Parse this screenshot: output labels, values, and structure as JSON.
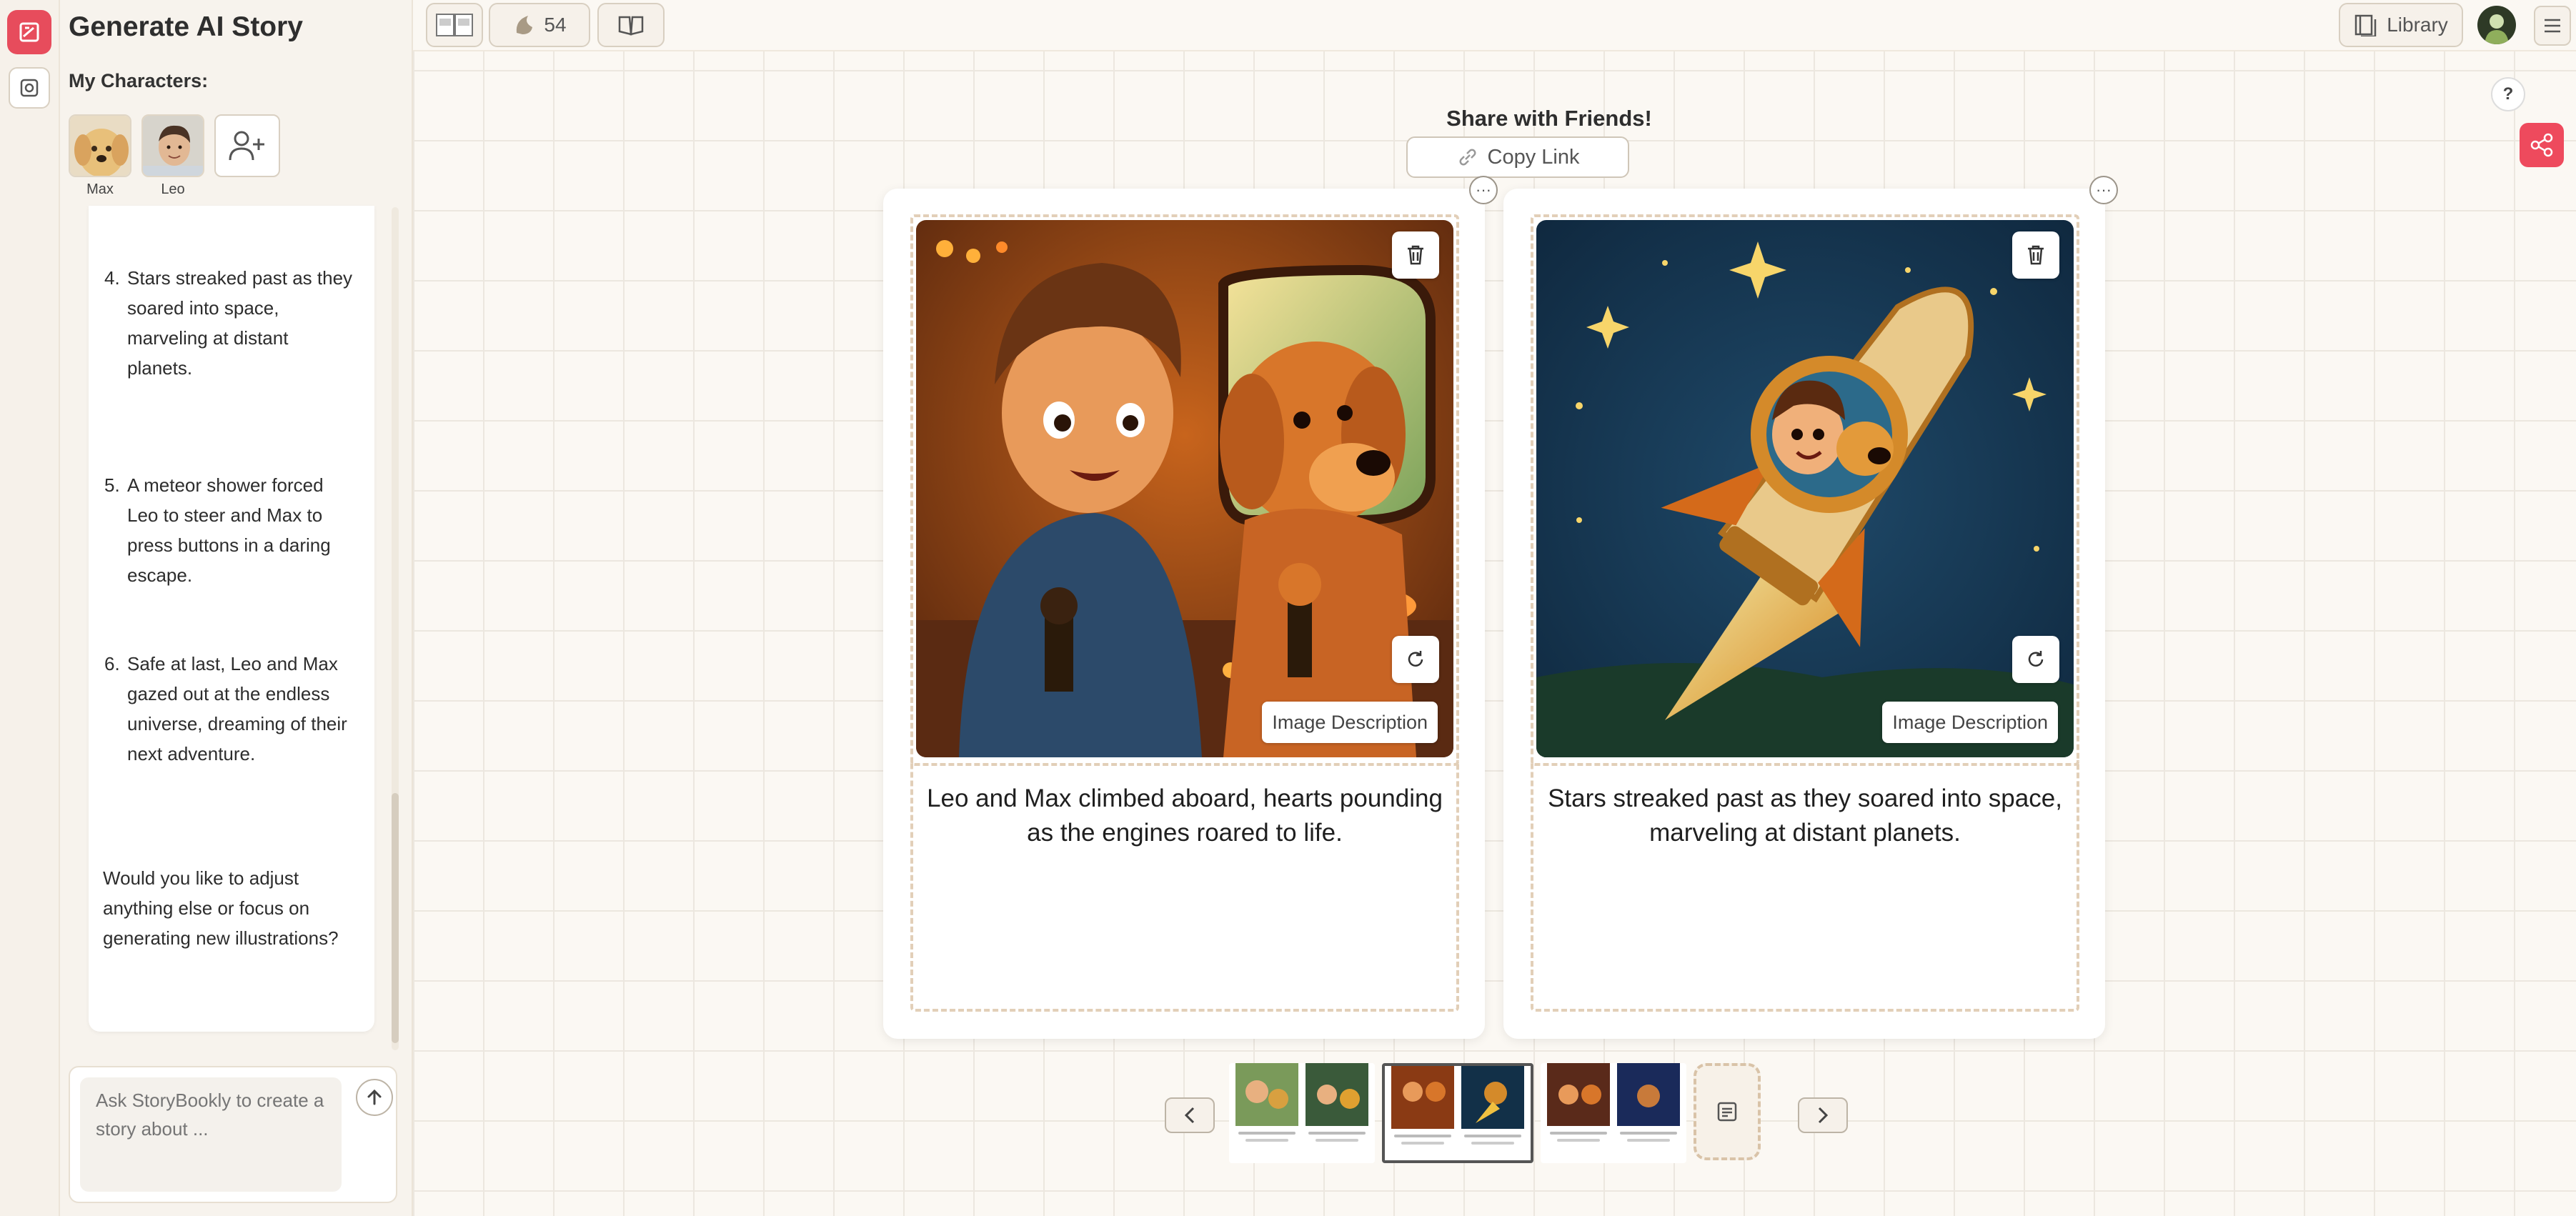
{
  "app": {
    "title": "Generate AI Story"
  },
  "characters": {
    "label": "My Characters:",
    "items": [
      {
        "name": "Max"
      },
      {
        "name": "Leo"
      }
    ]
  },
  "chat": {
    "story_items": [
      {
        "num": "4.",
        "text": "Stars streaked past as they soared into space, marveling at distant planets."
      },
      {
        "num": "5.",
        "text": "A meteor shower forced Leo to steer and Max to press buttons in a daring escape."
      },
      {
        "num": "6.",
        "text": "Safe at last, Leo and Max gazed out at the endless universe, dreaming of their next adventure."
      }
    ],
    "question": "Would you like to adjust anything else or focus on generating new illustrations?",
    "input_placeholder": "Ask StoryBookly to create a story about ..."
  },
  "toolbar": {
    "credits": "54",
    "library_label": "Library"
  },
  "share": {
    "title": "Share with Friends!",
    "copy_link_label": "Copy Link"
  },
  "pages": [
    {
      "text": "Leo and Max climbed aboard, hearts pounding as the engines roared to life.",
      "image_description_label": "Image Description"
    },
    {
      "text": "Stars streaked past as they soared into space, marveling at distant planets.",
      "image_description_label": "Image Description"
    }
  ],
  "help": {
    "label": "?"
  },
  "colors": {
    "accent": "#ee4a5d",
    "dashed_border": "#e2cfb8",
    "panel_bg": "#f7f3ed"
  },
  "icons": [
    "storybook-logo-icon",
    "settings-icon",
    "add-character-icon",
    "send-arrow-icon",
    "book-spread-icon",
    "credits-icon",
    "open-book-icon",
    "library-icon",
    "avatar",
    "menu-icon",
    "link-icon",
    "trash-icon",
    "regenerate-icon",
    "more-icon",
    "chevron-left-icon",
    "chevron-right-icon",
    "add-page-icon",
    "share-icon"
  ]
}
